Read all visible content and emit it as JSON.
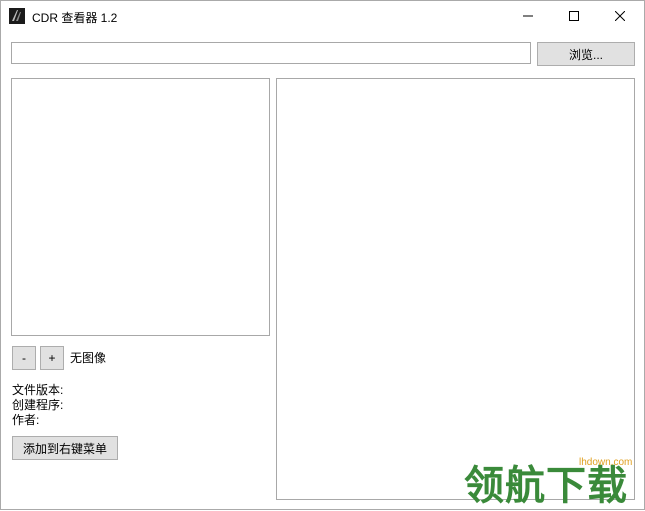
{
  "window": {
    "title": "CDR 查看器 1.2"
  },
  "toolbar": {
    "path_value": "",
    "browse_label": "浏览..."
  },
  "controls": {
    "zoom_out_label": "-",
    "zoom_in_label": "+",
    "no_image_label": "无图像"
  },
  "info": {
    "file_version_label": "文件版本:",
    "creator_label": "创建程序:",
    "author_label": "作者:"
  },
  "context_menu_button_label": "添加到右键菜单",
  "watermark": {
    "text": "领航下载",
    "url": "lhdown.com"
  },
  "icons": {
    "app": "cdr-app-icon",
    "minimize": "minimize-icon",
    "maximize": "maximize-icon",
    "close": "close-icon"
  }
}
